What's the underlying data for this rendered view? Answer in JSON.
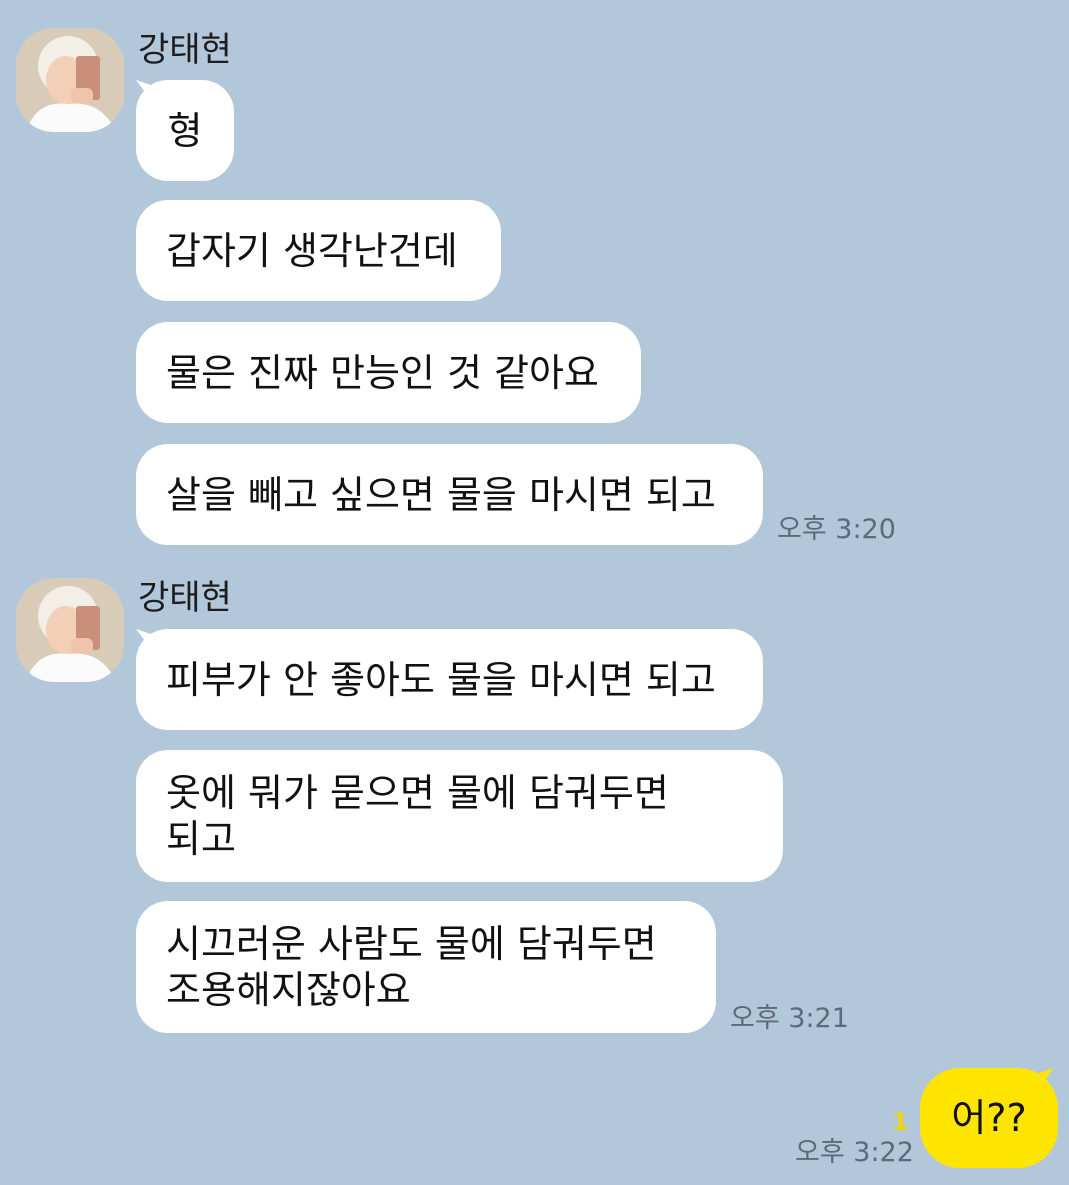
{
  "chat": {
    "groups": [
      {
        "sender": "강태현",
        "messages": [
          "형",
          "갑자기 생각난건데",
          "물은 진짜 만능인 것 같아요",
          "살을 빼고 싶으면 물을 마시면 되고"
        ],
        "time": "오후 3:20"
      },
      {
        "sender": "강태현",
        "messages": [
          "피부가 안 좋아도 물을 마시면 되고",
          [
            "옷에 뭐가 묻으면 물에 담궈두면",
            "되고"
          ],
          [
            "시끄러운 사람도 물에 담궈두면",
            "조용해지잖아요"
          ]
        ],
        "time": "오후 3:21"
      }
    ],
    "my_message": {
      "text": "어??",
      "unread_count": "1",
      "time": "오후 3:22"
    }
  },
  "colors": {
    "background": "#b2c7da",
    "bubble_other": "#ffffff",
    "bubble_mine": "#fee500",
    "unread": "#f2d400"
  },
  "icons": [
    "profile-avatar"
  ]
}
